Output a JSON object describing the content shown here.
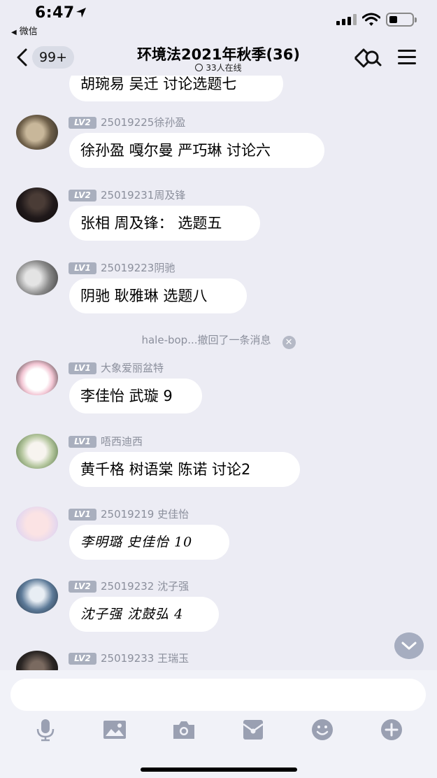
{
  "status_bar": {
    "time": "6:47",
    "back_app": "微信"
  },
  "header": {
    "unread_count": "99+",
    "title": "环境法2021年秋季(36)",
    "online": "33人在线"
  },
  "messages": [
    {
      "text": "胡琬易 吴迁 讨论选题七"
    },
    {
      "level": "LV2",
      "sender": "25019225徐孙盈",
      "text": "徐孙盈 嘎尔曼 严巧琳 讨论六"
    },
    {
      "level": "LV2",
      "sender": "25019231周及锋",
      "text": "张相 周及锋： 选题五"
    },
    {
      "level": "LV1",
      "sender": "25019223阴驰",
      "text": "阴驰 耿雅琳 选题八"
    },
    {
      "level": "LV1",
      "sender": "大象爱丽盆特",
      "text": "李佳怡 武璇 9"
    },
    {
      "level": "LV1",
      "sender": "唔西迪西",
      "text": "黄千格 树语棠 陈诺 讨论2"
    },
    {
      "level": "LV1",
      "sender": "25019219 史佳怡",
      "text": "李明璐 史佳怡 10"
    },
    {
      "level": "LV2",
      "sender": "25019232 沈子强",
      "text": "沈子强 沈鼓弘 4"
    },
    {
      "level": "LV2",
      "sender": "25019233 王瑞玉",
      "text": ""
    }
  ],
  "recall_notice": "hale-bop...撤回了一条消息",
  "icons": {
    "location_arrow": "location-arrow-icon",
    "invite": "invite-friends-icon",
    "menu": "menu-icon",
    "scroll_down": "chevron-down-icon",
    "toolbar": [
      "microphone-icon",
      "image-icon",
      "camera-icon",
      "red-packet-icon",
      "emoji-icon",
      "plus-icon"
    ]
  },
  "colors": {
    "background": "#ececf4",
    "bubble": "#ffffff",
    "level_badge": "#a9afbe",
    "meta_text": "#8b8f9c",
    "toolbar_icon": "#9aa0b2"
  }
}
